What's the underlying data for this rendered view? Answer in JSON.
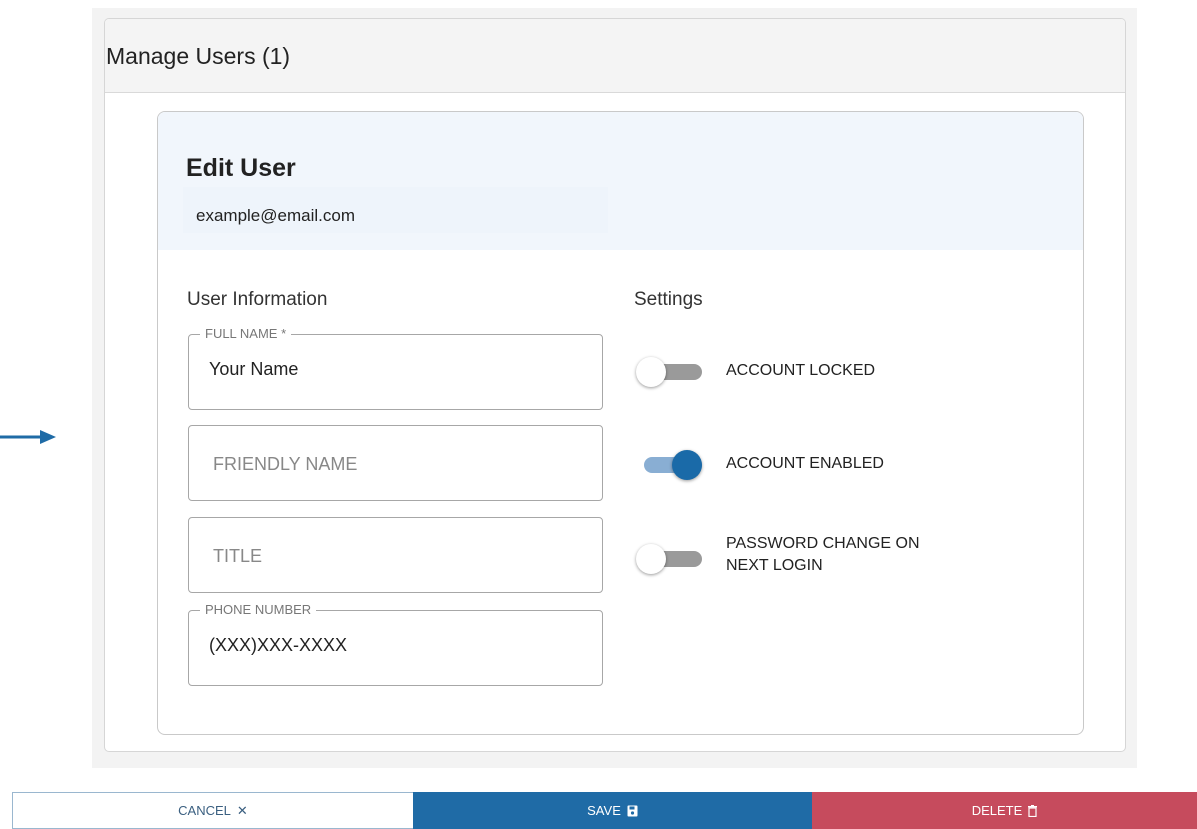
{
  "panel": {
    "title": "Manage Users (1)"
  },
  "edit": {
    "title": "Edit User",
    "email": "example@email.com"
  },
  "user_info": {
    "heading": "User Information",
    "fields": [
      {
        "label": "FULL NAME *",
        "value": "Your Name",
        "placeholder": ""
      },
      {
        "label": "",
        "value": "",
        "placeholder": "FRIENDLY NAME"
      },
      {
        "label": "",
        "value": "",
        "placeholder": "TITLE"
      },
      {
        "label": "PHONE NUMBER",
        "value": "(XXX)XXX-XXXX",
        "placeholder": ""
      }
    ]
  },
  "settings": {
    "heading": "Settings",
    "toggles": [
      {
        "label": "ACCOUNT LOCKED",
        "on": false
      },
      {
        "label": "ACCOUNT ENABLED",
        "on": true
      },
      {
        "label_line1": "PASSWORD CHANGE ON",
        "label_line2": "NEXT LOGIN",
        "on": false
      }
    ]
  },
  "actions": {
    "cancel_label": "CANCEL",
    "cancel_icon": "✕",
    "save_label": "SAVE",
    "save_icon": "floppy-disk-icon",
    "delete_label": "DELETE",
    "delete_icon": "trash-icon"
  },
  "colors": {
    "accent": "#1f6ba6",
    "danger": "#c64b5d",
    "toggle_on": "#1a6aa8"
  }
}
